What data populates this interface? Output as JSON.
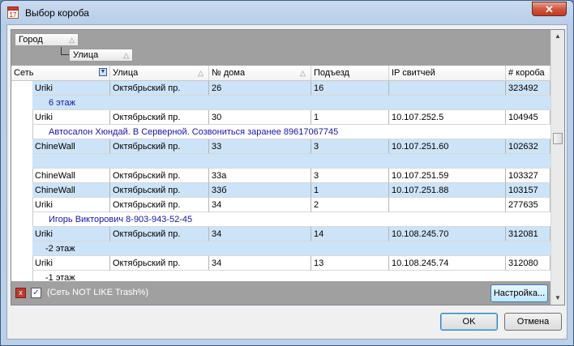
{
  "window": {
    "title": "Выбор короба",
    "calendar_icon_text": "17",
    "close_label": "✕"
  },
  "group_panel": {
    "chips": [
      "Город",
      "Улица"
    ]
  },
  "grid": {
    "columns": [
      "Сеть",
      "Улица",
      "№ дома",
      "Подъезд",
      "IP свитчей",
      "# короба"
    ],
    "sort_glyph": "△",
    "filter_glyph": "▼",
    "rows": [
      {
        "kind": "data",
        "selected": true,
        "cells": [
          "Uriki",
          "Октябрьский пр.",
          "26",
          "16",
          "",
          "323492"
        ]
      },
      {
        "kind": "note",
        "selected": true,
        "blue": true,
        "text": "6 этаж"
      },
      {
        "kind": "data",
        "selected": false,
        "cells": [
          "Uriki",
          "Октябрьский пр.",
          "30",
          "1",
          "10.107.252.5",
          "104945"
        ]
      },
      {
        "kind": "note",
        "selected": false,
        "blue": true,
        "text": "Автосалон Хюндай. В Серверной. Созвониться заранее 89617067745"
      },
      {
        "kind": "data",
        "selected": true,
        "cells": [
          "ChineWall",
          "Октябрьский пр.",
          "33",
          "3",
          "10.107.251.60",
          "102632"
        ]
      },
      {
        "kind": "note",
        "selected": true,
        "blue": true,
        "text": ""
      },
      {
        "kind": "data",
        "selected": false,
        "cells": [
          "ChineWall",
          "Октябрьский пр.",
          "33а",
          "3",
          "10.107.251.59",
          "103327"
        ]
      },
      {
        "kind": "data",
        "selected": true,
        "cells": [
          "ChineWall",
          "Октябрьский пр.",
          "33б",
          "1",
          "10.107.251.88",
          "103157"
        ]
      },
      {
        "kind": "data",
        "selected": false,
        "cells": [
          "Uriki",
          "Октябрьский пр.",
          "34",
          "2",
          "",
          "277635"
        ]
      },
      {
        "kind": "note",
        "selected": false,
        "blue": true,
        "text": "Игорь Викторович 8-903-943-52-45"
      },
      {
        "kind": "data",
        "selected": true,
        "cells": [
          "Uriki",
          "Октябрьский пр.",
          "34",
          "14",
          "10.108.245.70",
          "312081"
        ]
      },
      {
        "kind": "note",
        "selected": true,
        "blue": false,
        "text": "-2 этаж"
      },
      {
        "kind": "data",
        "selected": false,
        "cells": [
          "Uriki",
          "Октябрьский пр.",
          "34",
          "13",
          "10.108.245.74",
          "312080"
        ]
      },
      {
        "kind": "note",
        "selected": false,
        "blue": false,
        "text": "-1 этаж"
      }
    ]
  },
  "filter": {
    "clear_label": "x",
    "enabled_mark": "✓",
    "text": "(Сеть NOT LIKE Trash%)",
    "settings_label": "Настройка..."
  },
  "buttons": {
    "ok": "OK",
    "cancel": "Отмена"
  },
  "scrollbar": {
    "up_arrow": "▲",
    "down_arrow": "▼"
  }
}
